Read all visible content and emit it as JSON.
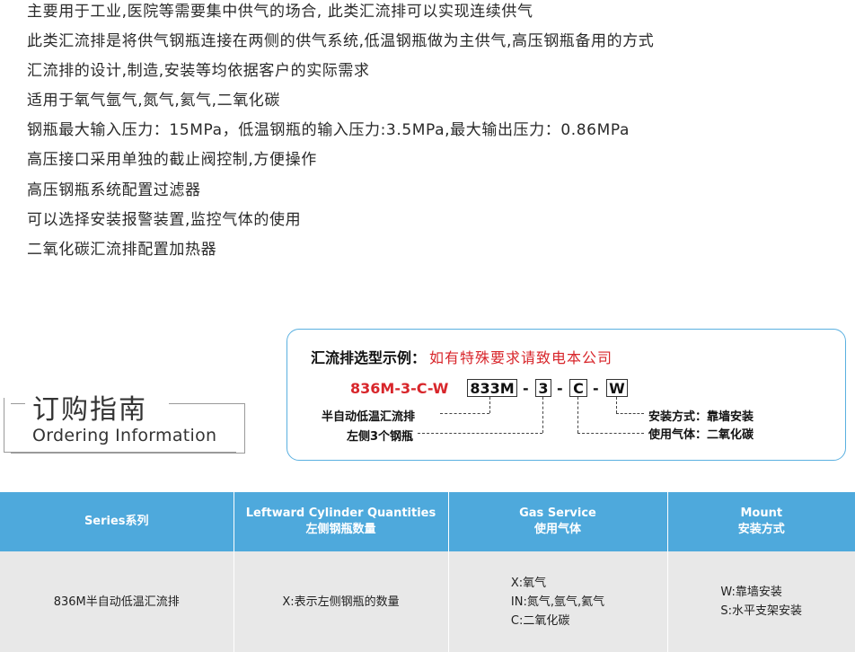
{
  "features": [
    "主要用于工业,医院等需要集中供气的场合, 此类汇流排可以实现连续供气",
    "此类汇流排是将供气钢瓶连接在两侧的供气系统,低温钢瓶做为主供气,高压钢瓶备用的方式",
    "汇流排的设计,制造,安装等均依据客户的实际需求",
    "适用于氧气氩气,氮气,氦气,二氧化碳",
    "钢瓶最大输入压力：15MPa，低温钢瓶的输入压力:3.5MPa,最大输出压力：0.86MPa",
    "高压接口采用单独的截止阀控制,方便操作",
    "高压钢瓶系统配置过滤器",
    "可以选择安装报警装置,监控气体的使用",
    "二氧化碳汇流排配置加热器"
  ],
  "guide": {
    "title_cn": "订购指南",
    "title_en": "Ordering Information"
  },
  "example": {
    "title": "汇流排选型示例：",
    "note": "如有特殊要求请致电本公司",
    "model": "836M-3-C-W",
    "codes": {
      "series": "833M",
      "qty": "3",
      "gas": "C",
      "mount": "W"
    },
    "dash": "-",
    "labels": {
      "series": "半自动低温汇流排",
      "qty": "左侧3个钢瓶",
      "mount": "安装方式：靠墙安装",
      "gas": "使用气体：二氧化碳"
    }
  },
  "table": {
    "headers": [
      {
        "en": "Series系列",
        "cn": ""
      },
      {
        "en": "Leftward Cylinder Quantities",
        "cn": "左侧钢瓶数量"
      },
      {
        "en": "Gas Service",
        "cn": "使用气体"
      },
      {
        "en": "Mount",
        "cn": "安装方式"
      }
    ],
    "row": {
      "series": "836M半自动低温汇流排",
      "qty": "X:表示左侧钢瓶的数量",
      "gas": [
        "X:氧气",
        "IN:氮气,氩气,氦气",
        "C:二氧化碳"
      ],
      "mount": [
        "W:靠墙安装",
        "S:水平支架安装"
      ]
    }
  },
  "colors": {
    "header_blue": "#4ea9dc",
    "accent_red": "#d8262b",
    "box_border": "#5ab0e0",
    "cell_gray": "#e8e8e8"
  }
}
